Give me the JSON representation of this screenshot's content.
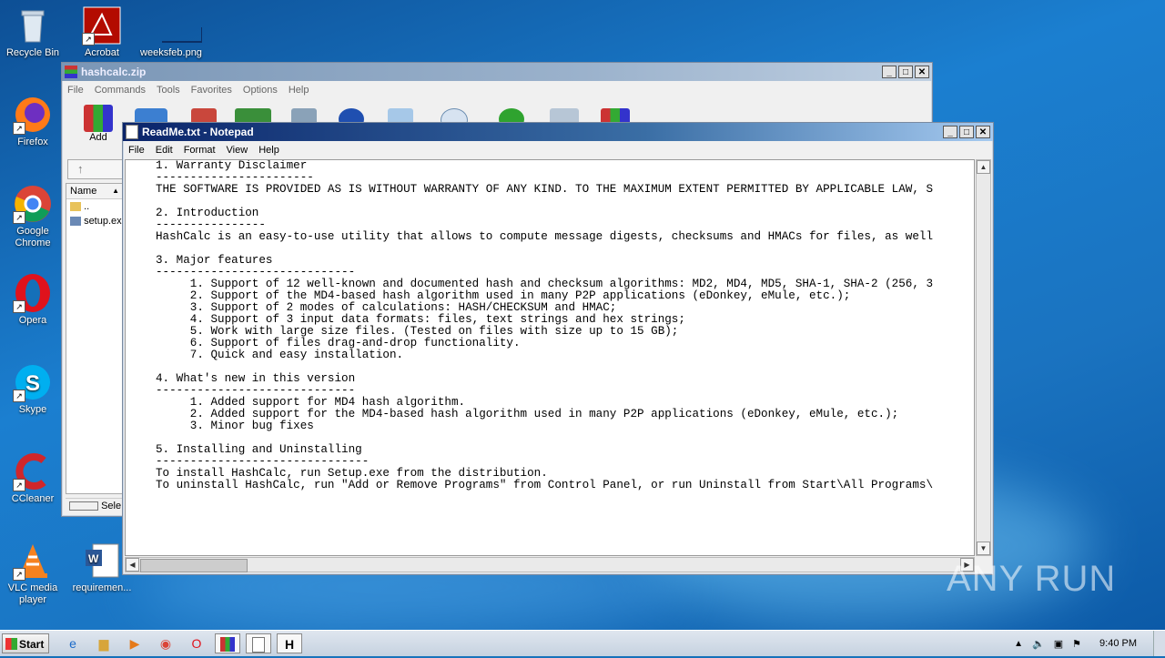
{
  "desktop": {
    "icons": [
      {
        "label": "Recycle Bin"
      },
      {
        "label": "Acrobat"
      },
      {
        "label": "weeksfeb.png"
      },
      {
        "label": "Firefox"
      },
      {
        "label": "Google Chrome"
      },
      {
        "label": "Opera"
      },
      {
        "label": "Skype"
      },
      {
        "label": "CCleaner"
      },
      {
        "label": "VLC media player"
      },
      {
        "label": "requiremen..."
      }
    ],
    "watermark": "ANY RUN"
  },
  "winrar": {
    "title": "hashcalc.zip",
    "menu": [
      "File",
      "Commands",
      "Tools",
      "Favorites",
      "Options",
      "Help"
    ],
    "add_label": "Add",
    "column_name": "Name",
    "files": [
      "..",
      "setup.ex"
    ],
    "status_sel": "Sele"
  },
  "notepad": {
    "title": "ReadMe.txt - Notepad",
    "menu": [
      "File",
      "Edit",
      "Format",
      "View",
      "Help"
    ],
    "content": "1. Warranty Disclaimer\n-----------------------\nTHE SOFTWARE IS PROVIDED AS IS WITHOUT WARRANTY OF ANY KIND. TO THE MAXIMUM EXTENT PERMITTED BY APPLICABLE LAW, S\n\n2. Introduction\n----------------\nHashCalc is an easy-to-use utility that allows to compute message digests, checksums and HMACs for files, as well\n\n3. Major features\n-----------------------------\n     1. Support of 12 well-known and documented hash and checksum algorithms: MD2, MD4, MD5, SHA-1, SHA-2 (256, 3\n     2. Support of the MD4-based hash algorithm used in many P2P applications (eDonkey, eMule, etc.);\n     3. Support of 2 modes of calculations: HASH/CHECKSUM and HMAC;\n     4. Support of 3 input data formats: files, text strings and hex strings;\n     5. Work with large size files. (Tested on files with size up to 15 GB);\n     6. Support of files drag-and-drop functionality.\n     7. Quick and easy installation.\n\n4. What's new in this version\n-----------------------------\n     1. Added support for MD4 hash algorithm.\n     2. Added support for the MD4-based hash algorithm used in many P2P applications (eDonkey, eMule, etc.);\n     3. Minor bug fixes\n\n5. Installing and Uninstalling\n-------------------------------\nTo install HashCalc, run Setup.exe from the distribution.\nTo uninstall HashCalc, run \"Add or Remove Programs\" from Control Panel, or run Uninstall from Start\\All Programs\\"
  },
  "taskbar": {
    "start_label": "Start",
    "clock": "9:40 PM"
  },
  "colors": {
    "desktop": "#1570b9",
    "title_active": "#0a246a",
    "title_inactive": "#7a96b6"
  }
}
